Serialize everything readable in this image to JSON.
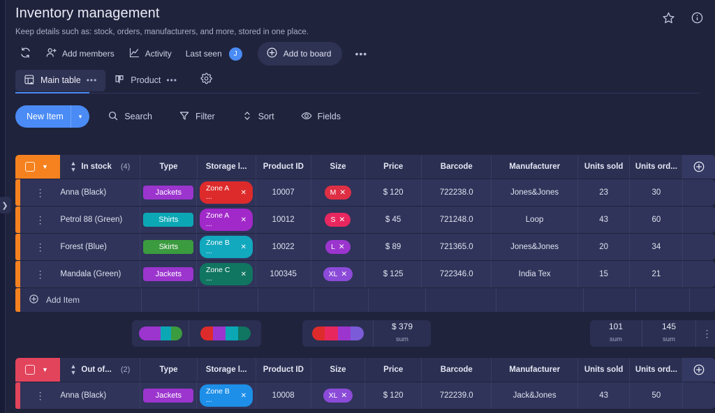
{
  "board": {
    "title": "Inventory management",
    "subtitle": "Keep details such as: stock, orders, manufacturers, and more, stored in one place.",
    "favorite_icon": "star-icon",
    "info_icon": "info-icon"
  },
  "meta": {
    "refresh_icon": "refresh-history-icon",
    "add_members_label": "Add members",
    "activity_label": "Activity",
    "last_seen_label": "Last seen",
    "avatar_initial": "J",
    "add_to_board_label": "Add to board",
    "more_label": "•••"
  },
  "tabs": {
    "items": [
      {
        "label": "Main table",
        "icon": "table-home-icon",
        "active": true,
        "dots": "•••"
      },
      {
        "label": "Product",
        "icon": "kanban-icon",
        "active": false,
        "dots": "•••"
      }
    ],
    "settings_icon": "gear-icon"
  },
  "toolbar": {
    "new_item_label": "New Item",
    "new_item_caret": "▾",
    "items": [
      {
        "label": "Search",
        "icon": "search-icon"
      },
      {
        "label": "Filter",
        "icon": "filter-icon"
      },
      {
        "label": "Sort",
        "icon": "sort-icon"
      },
      {
        "label": "Fields",
        "icon": "eye-icon"
      }
    ]
  },
  "table": {
    "columns": [
      "Type",
      "Storage l...",
      "Product ID",
      "Size",
      "Price",
      "Barcode",
      "Manufacturer",
      "Units sold",
      "Units ord..."
    ],
    "add_column_icon": "plus-circle-icon",
    "groups": [
      {
        "name": "In stock",
        "count": "(4)",
        "color": "#f5821f",
        "add_item_label": "Add Item",
        "rows": [
          {
            "name": "Anna (Black)",
            "type": {
              "label": "Jackets",
              "color": "#9B35CE"
            },
            "storage": {
              "label": "Zone A ...",
              "color": "#DD2B2B"
            },
            "product_id": "10007",
            "size": {
              "label": "M",
              "color": "#DF2F44"
            },
            "price": "$ 120",
            "barcode": "722238.0",
            "manufacturer": "Jones&Jones",
            "units_sold": "23",
            "units_ordered": "30"
          },
          {
            "name": "Petrol 88 (Green)",
            "type": {
              "label": "Shirts",
              "color": "#0CA7B5"
            },
            "storage": {
              "label": "Zone A ...",
              "color": "#A129C9"
            },
            "product_id": "10012",
            "size": {
              "label": "S",
              "color": "#E8275F"
            },
            "price": "$ 45",
            "barcode": "721248.0",
            "manufacturer": "Loop",
            "units_sold": "43",
            "units_ordered": "60"
          },
          {
            "name": "Forest (Blue)",
            "type": {
              "label": "Skirts",
              "color": "#3B9B3F"
            },
            "storage": {
              "label": "Zone B ...",
              "color": "#12A8BE"
            },
            "product_id": "10022",
            "size": {
              "label": "L",
              "color": "#9B35CE"
            },
            "price": "$ 89",
            "barcode": "721365.0",
            "manufacturer": "Jones&Jones",
            "units_sold": "20",
            "units_ordered": "34"
          },
          {
            "name": "Mandala (Green)",
            "type": {
              "label": "Jackets",
              "color": "#9B35CE"
            },
            "storage": {
              "label": "Zone C ...",
              "color": "#107561"
            },
            "product_id": "100345",
            "size": {
              "label": "XL",
              "color": "#8B4BD8"
            },
            "price": "$ 125",
            "barcode": "722346.0",
            "manufacturer": "India Tex",
            "units_sold": "15",
            "units_ordered": "21"
          }
        ],
        "summary": {
          "type_battery": [
            {
              "color": "#9B35CE",
              "weight": 50
            },
            {
              "color": "#0CA7B5",
              "weight": 25
            },
            {
              "color": "#3B9B3F",
              "weight": 25
            }
          ],
          "storage_battery": [
            {
              "color": "#DD2B2B",
              "weight": 25
            },
            {
              "color": "#9B35CE",
              "weight": 25
            },
            {
              "color": "#0CA7B5",
              "weight": 25
            },
            {
              "color": "#107561",
              "weight": 25
            }
          ],
          "size_battery": [
            {
              "color": "#DD2B2B",
              "weight": 25
            },
            {
              "color": "#E8275F",
              "weight": 25
            },
            {
              "color": "#9B35CE",
              "weight": 25
            },
            {
              "color": "#7C5BD8",
              "weight": 25
            }
          ],
          "price_value": "$ 379",
          "price_label": "sum",
          "units_sold_value": "101",
          "units_sold_label": "sum",
          "units_ordered_value": "145",
          "units_ordered_label": "sum"
        }
      },
      {
        "name": "Out of...",
        "count": "(2)",
        "color": "#e2445c",
        "rows": [
          {
            "name": "Anna (Black)",
            "type": {
              "label": "Jackets",
              "color": "#9B35CE"
            },
            "storage": {
              "label": "Zone B ...",
              "color": "#1E8FE8"
            },
            "product_id": "10008",
            "size": {
              "label": "XL",
              "color": "#8B4BD8"
            },
            "price": "$ 120",
            "barcode": "722239.0",
            "manufacturer": "Jack&Jones",
            "units_sold": "43",
            "units_ordered": "50"
          }
        ]
      }
    ]
  },
  "colors": {
    "background": "#20233c",
    "accent_blue": "#4a8bf5",
    "group_orange": "#f5821f",
    "group_red": "#e2445c",
    "header_cell": "#2b2f52",
    "row_cell": "#30345a"
  }
}
